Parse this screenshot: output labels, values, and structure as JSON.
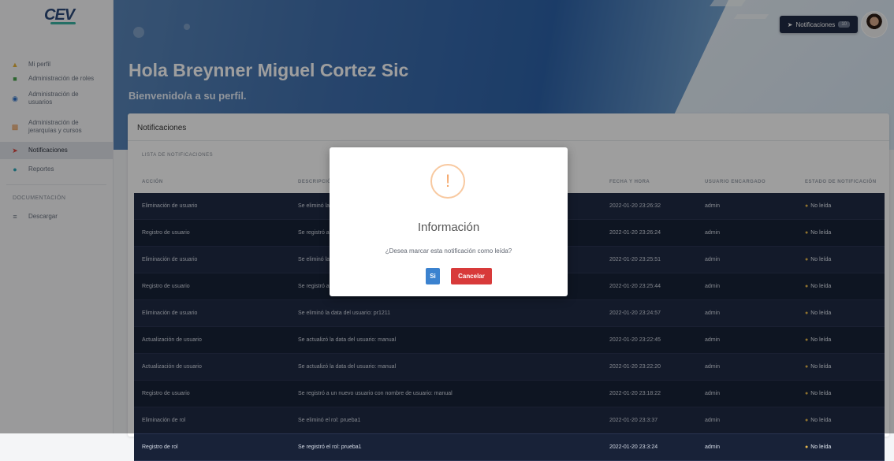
{
  "sidebar": {
    "logo_text": "CEV",
    "items": [
      {
        "label": "Mi perfil",
        "icon": "user-icon"
      },
      {
        "label": "Administración de roles",
        "icon": "roles-icon"
      },
      {
        "label": "Administración de usuarios",
        "icon": "users-icon"
      },
      {
        "label": "Administración de jerarquías y cursos",
        "icon": "hierarchy-icon"
      },
      {
        "label": "Notificaciones",
        "icon": "notifications-icon"
      },
      {
        "label": "Reportes",
        "icon": "reports-icon"
      }
    ],
    "section": "DOCUMENTACIÓN",
    "download": {
      "label": "Descargar",
      "icon": "download-icon"
    }
  },
  "header": {
    "greeting": "Hola Breynner Miguel Cortez Sic",
    "subtitle": "Bienvenido/a a su perfil.",
    "notif_button": "Notificaciones",
    "notif_badge": "10"
  },
  "card": {
    "title": "Notificaciones",
    "list_title": "LISTA DE NOTIFICACIONES"
  },
  "table": {
    "columns": [
      "ACCIÓN",
      "DESCRIPCIÓN",
      "FECHA Y HORA",
      "USUARIO ENCARGADO",
      "ESTADO DE NOTIFICACIÓN"
    ],
    "rows": [
      {
        "accion": "Eliminación de usuario",
        "descripcion": "Se eliminó la data del",
        "fecha": "2022-01-20 23:26:32",
        "usuario": "admin",
        "estado": "No leída"
      },
      {
        "accion": "Registro de usuario",
        "descripcion": "Se registró a un nuevo",
        "fecha": "2022-01-20 23:26:24",
        "usuario": "admin",
        "estado": "No leída"
      },
      {
        "accion": "Eliminación de usuario",
        "descripcion": "Se eliminó la data del",
        "fecha": "2022-01-20 23:25:51",
        "usuario": "admin",
        "estado": "No leída"
      },
      {
        "accion": "Registro de usuario",
        "descripcion": "Se registró a un nuevo",
        "fecha": "2022-01-20 23:25:44",
        "usuario": "admin",
        "estado": "No leída"
      },
      {
        "accion": "Eliminación de usuario",
        "descripcion": "Se eliminó la data del usuario: pr1211",
        "fecha": "2022-01-20 23:24:57",
        "usuario": "admin",
        "estado": "No leída"
      },
      {
        "accion": "Actualización de usuario",
        "descripcion": "Se actualizó la data del usuario: manual",
        "fecha": "2022-01-20 23:22:45",
        "usuario": "admin",
        "estado": "No leída"
      },
      {
        "accion": "Actualización de usuario",
        "descripcion": "Se actualizó la data del usuario: manual",
        "fecha": "2022-01-20 23:22:20",
        "usuario": "admin",
        "estado": "No leída"
      },
      {
        "accion": "Registro de usuario",
        "descripcion": "Se registró a un nuevo usuario con nombre de usuario: manual",
        "fecha": "2022-01-20 23:18:22",
        "usuario": "admin",
        "estado": "No leída"
      },
      {
        "accion": "Eliminación de rol",
        "descripcion": "Se eliminó el rol: prueba1",
        "fecha": "2022-01-20 23:3:37",
        "usuario": "admin",
        "estado": "No leída"
      },
      {
        "accion": "Registro de rol",
        "descripcion": "Se registró el rol: prueba1",
        "fecha": "2022-01-20 23:3:24",
        "usuario": "admin",
        "estado": "No leída"
      }
    ]
  },
  "modal": {
    "icon": "!",
    "title": "Información",
    "message": "¿Desea marcar esta notificación como leída?",
    "confirm": "Si",
    "cancel": "Cancelar"
  },
  "colors": {
    "table_row": "#1f2a44",
    "confirm": "#3b82cf",
    "cancel": "#d83a3a",
    "warning": "#f5a76a"
  }
}
